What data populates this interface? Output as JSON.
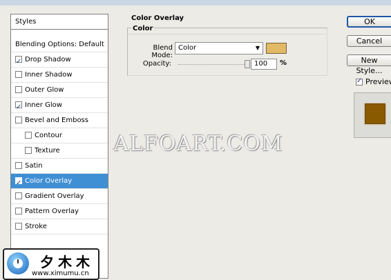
{
  "styles_panel": {
    "header": "Styles",
    "items": [
      {
        "label": "Blending Options: Default",
        "checkbox": false,
        "checked": false,
        "indent": false,
        "selected": false
      },
      {
        "label": "Drop Shadow",
        "checkbox": true,
        "checked": true,
        "indent": false,
        "selected": false
      },
      {
        "label": "Inner Shadow",
        "checkbox": true,
        "checked": false,
        "indent": false,
        "selected": false
      },
      {
        "label": "Outer Glow",
        "checkbox": true,
        "checked": false,
        "indent": false,
        "selected": false
      },
      {
        "label": "Inner Glow",
        "checkbox": true,
        "checked": true,
        "indent": false,
        "selected": false
      },
      {
        "label": "Bevel and Emboss",
        "checkbox": true,
        "checked": false,
        "indent": false,
        "selected": false
      },
      {
        "label": "Contour",
        "checkbox": true,
        "checked": false,
        "indent": true,
        "selected": false
      },
      {
        "label": "Texture",
        "checkbox": true,
        "checked": false,
        "indent": true,
        "selected": false
      },
      {
        "label": "Satin",
        "checkbox": true,
        "checked": false,
        "indent": false,
        "selected": false
      },
      {
        "label": "Color Overlay",
        "checkbox": true,
        "checked": true,
        "indent": false,
        "selected": true
      },
      {
        "label": "Gradient Overlay",
        "checkbox": true,
        "checked": false,
        "indent": false,
        "selected": false
      },
      {
        "label": "Pattern Overlay",
        "checkbox": true,
        "checked": false,
        "indent": false,
        "selected": false
      },
      {
        "label": "Stroke",
        "checkbox": true,
        "checked": false,
        "indent": false,
        "selected": false
      }
    ]
  },
  "color_overlay": {
    "title": "Color Overlay",
    "group_title": "Color",
    "blend_mode_label": "Blend Mode:",
    "blend_mode_value": "Color",
    "overlay_color": "#e2b964",
    "opacity_label": "Opacity:",
    "opacity_value": "100",
    "opacity_unit": "%",
    "opacity_fraction": 1.0
  },
  "buttons": {
    "ok": "OK",
    "cancel": "Cancel",
    "new_style": "New Style..."
  },
  "preview": {
    "label": "Preview",
    "checked": true,
    "swatch_color": "#8a5a00"
  },
  "watermark": "ALFOART.COM",
  "logo": {
    "chinese": "夕木木",
    "url": "www.ximumu.cn"
  }
}
